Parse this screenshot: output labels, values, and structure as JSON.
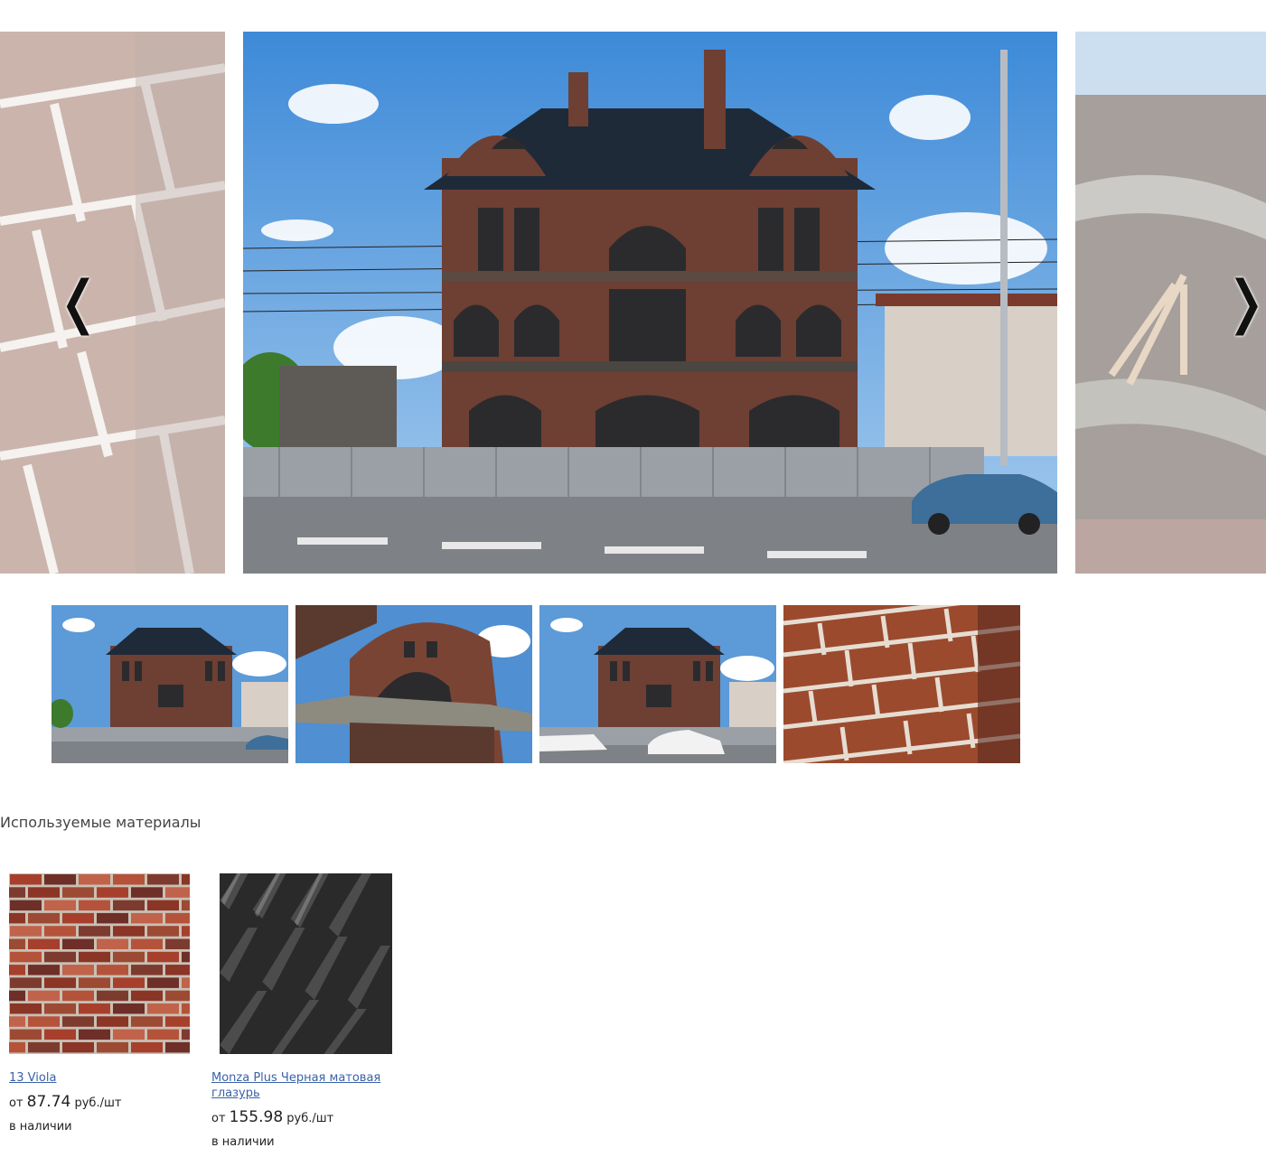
{
  "carousel": {
    "prev_arrow": "❬",
    "next_arrow": "❭",
    "main_image": "house-facade-photo",
    "side_left_image": "brick-wall-closeup-photo",
    "side_right_image": "balcony-detail-photo"
  },
  "thumbnails": [
    {
      "image": "house-facade-photo"
    },
    {
      "image": "tower-bay-window-photo"
    },
    {
      "image": "house-facade-street-photo"
    },
    {
      "image": "brick-wall-closeup-photo"
    }
  ],
  "materials": {
    "title": "Используемые материалы",
    "items": [
      {
        "name": "13 Viola",
        "price_prefix": "от",
        "price": "87.74",
        "unit": "руб./шт",
        "stock": "в наличии",
        "swatch": "red-brick-swatch"
      },
      {
        "name": "Monza Plus Черная матовая глазурь",
        "price_prefix": "от",
        "price": "155.98",
        "unit": "руб./шт",
        "stock": "в наличии",
        "swatch": "black-roof-tile-swatch"
      }
    ]
  }
}
